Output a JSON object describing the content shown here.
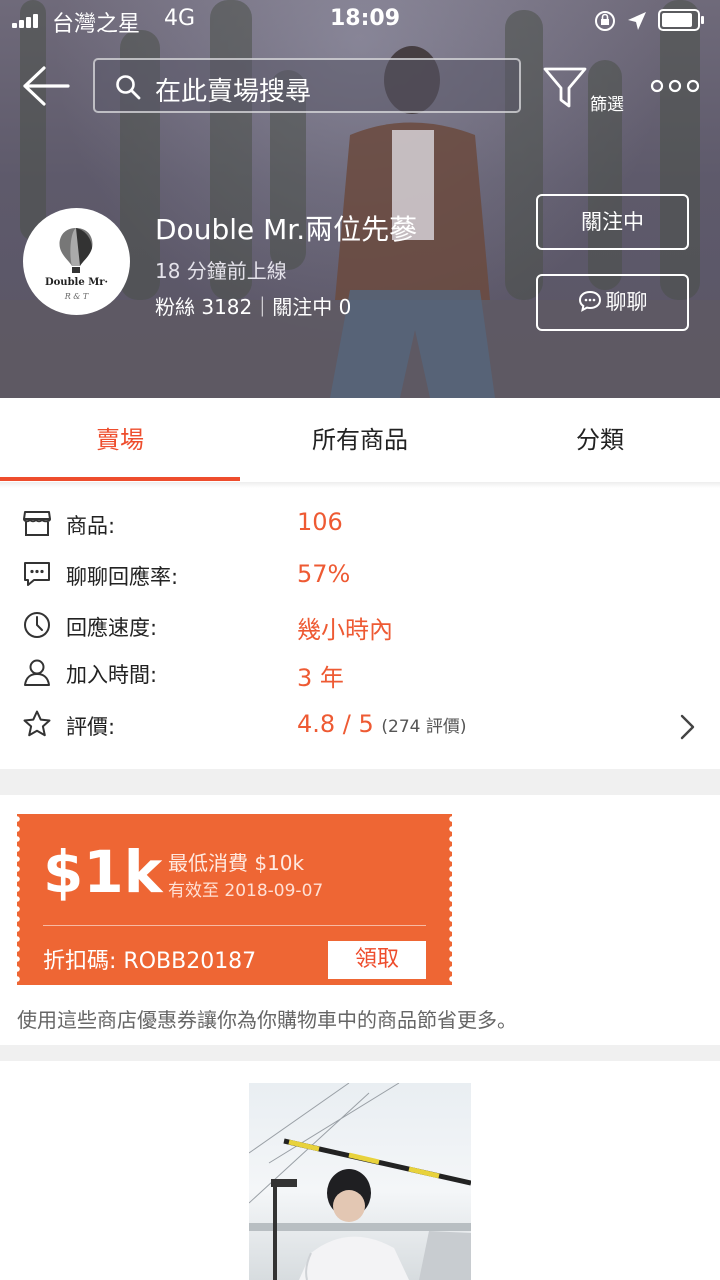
{
  "status_bar": {
    "carrier": "台灣之星",
    "network": "4G",
    "time": "18:09"
  },
  "nav": {
    "search_placeholder": "在此賣場搜尋",
    "filter_label": "篩選"
  },
  "shop": {
    "name": "Double Mr.兩位先蔘",
    "online_status": "18 分鐘前上線",
    "stats": "粉絲 3182｜關注中 0",
    "avatar_text": "Double Mr·",
    "avatar_subtext": "R & T",
    "follow_label": "關注中",
    "chat_label": "聊聊"
  },
  "tabs": [
    {
      "label": "賣場",
      "active": true
    },
    {
      "label": "所有商品",
      "active": false
    },
    {
      "label": "分類",
      "active": false
    }
  ],
  "info": {
    "products": {
      "label": "商品:",
      "value": "106"
    },
    "chat_rate": {
      "label": "聊聊回應率:",
      "value": "57%"
    },
    "response_speed": {
      "label": "回應速度:",
      "value": "幾小時內"
    },
    "joined": {
      "label": "加入時間:",
      "value": "3 年"
    },
    "rating": {
      "label": "評價:",
      "value": "4.8 / 5",
      "count": "(274 評價)"
    }
  },
  "coupon": {
    "amount": "$1k",
    "min_spend": "最低消費 $10k",
    "valid_until": "有效至 2018-09-07",
    "code": "折扣碼: ROBB20187",
    "claim_label": "領取",
    "description": "使用這些商店優惠券讓你為你購物車中的商品節省更多。"
  },
  "colors": {
    "accent": "#ee4d2d",
    "coupon_bg": "#ee6634"
  }
}
